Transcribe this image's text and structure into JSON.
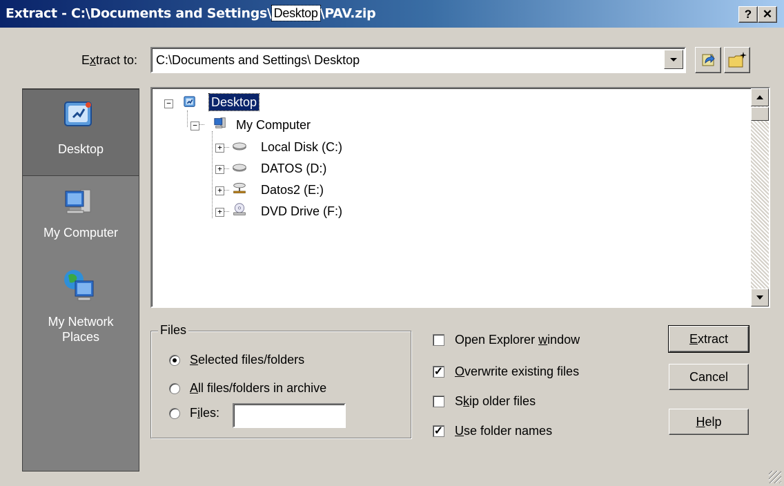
{
  "window": {
    "title_prefix": "Extract - C:\\Documents and Settings\\",
    "title_highlight": "Desktop",
    "title_suffix": "\\PAV.zip",
    "help_button": "?",
    "close_button": "✕"
  },
  "extract_to": {
    "label_pre": "E",
    "label_ul": "x",
    "label_post": "tract to:",
    "value": "C:\\Documents and Settings\\ Desktop"
  },
  "places": {
    "items": [
      {
        "label": "Desktop",
        "icon": "desktop-icon",
        "selected": true
      },
      {
        "label": "My Computer",
        "icon": "my-computer-icon"
      },
      {
        "label": "My Network Places",
        "icon": "network-places-icon"
      }
    ]
  },
  "tree": {
    "root": {
      "label": "Desktop",
      "expanded": true,
      "selected": true
    },
    "computer": {
      "label": "My Computer",
      "expanded": true
    },
    "drives": [
      {
        "label": "Local Disk (C:)",
        "icon": "hard-disk-icon"
      },
      {
        "label": "DATOS (D:)",
        "icon": "hard-disk-icon"
      },
      {
        "label": "Datos2 (E:)",
        "icon": "network-drive-icon"
      },
      {
        "label": "DVD Drive (F:)",
        "icon": "dvd-drive-icon"
      }
    ]
  },
  "files_group": {
    "legend": "Files",
    "options": [
      {
        "pre": "",
        "ul": "S",
        "post": "elected files/folders",
        "checked": true
      },
      {
        "pre": "",
        "ul": "A",
        "post": "ll files/folders in archive",
        "checked": false
      },
      {
        "pre": "F",
        "ul": "i",
        "post": "les:",
        "checked": false
      }
    ],
    "files_value": ""
  },
  "checkboxes": [
    {
      "pre": "Open Explorer ",
      "ul": "w",
      "post": "indow",
      "checked": false
    },
    {
      "pre": "",
      "ul": "O",
      "post": "verwrite existing files",
      "checked": true
    },
    {
      "pre": "S",
      "ul": "k",
      "post": "ip older files",
      "checked": false
    },
    {
      "pre": "",
      "ul": "U",
      "post": "se folder names",
      "checked": true
    }
  ],
  "buttons": {
    "extract": {
      "ul": "E",
      "post": "xtract"
    },
    "cancel": "Cancel",
    "help": {
      "ul": "H",
      "post": "elp"
    }
  }
}
